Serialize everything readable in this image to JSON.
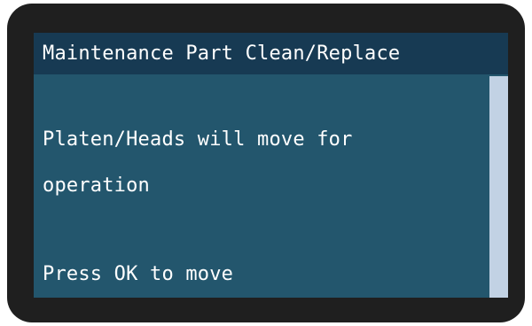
{
  "dialog": {
    "title": "Maintenance Part Clean/Replace",
    "message_lines": [
      "Platen/Heads will move for",
      "operation",
      "Press OK to move"
    ]
  },
  "colors": {
    "bezel": "#1f1f1f",
    "title_bar": "#173a53",
    "screen_background": "#23566d",
    "text": "#ffffff",
    "scrollbar": "#c2d2e4"
  }
}
